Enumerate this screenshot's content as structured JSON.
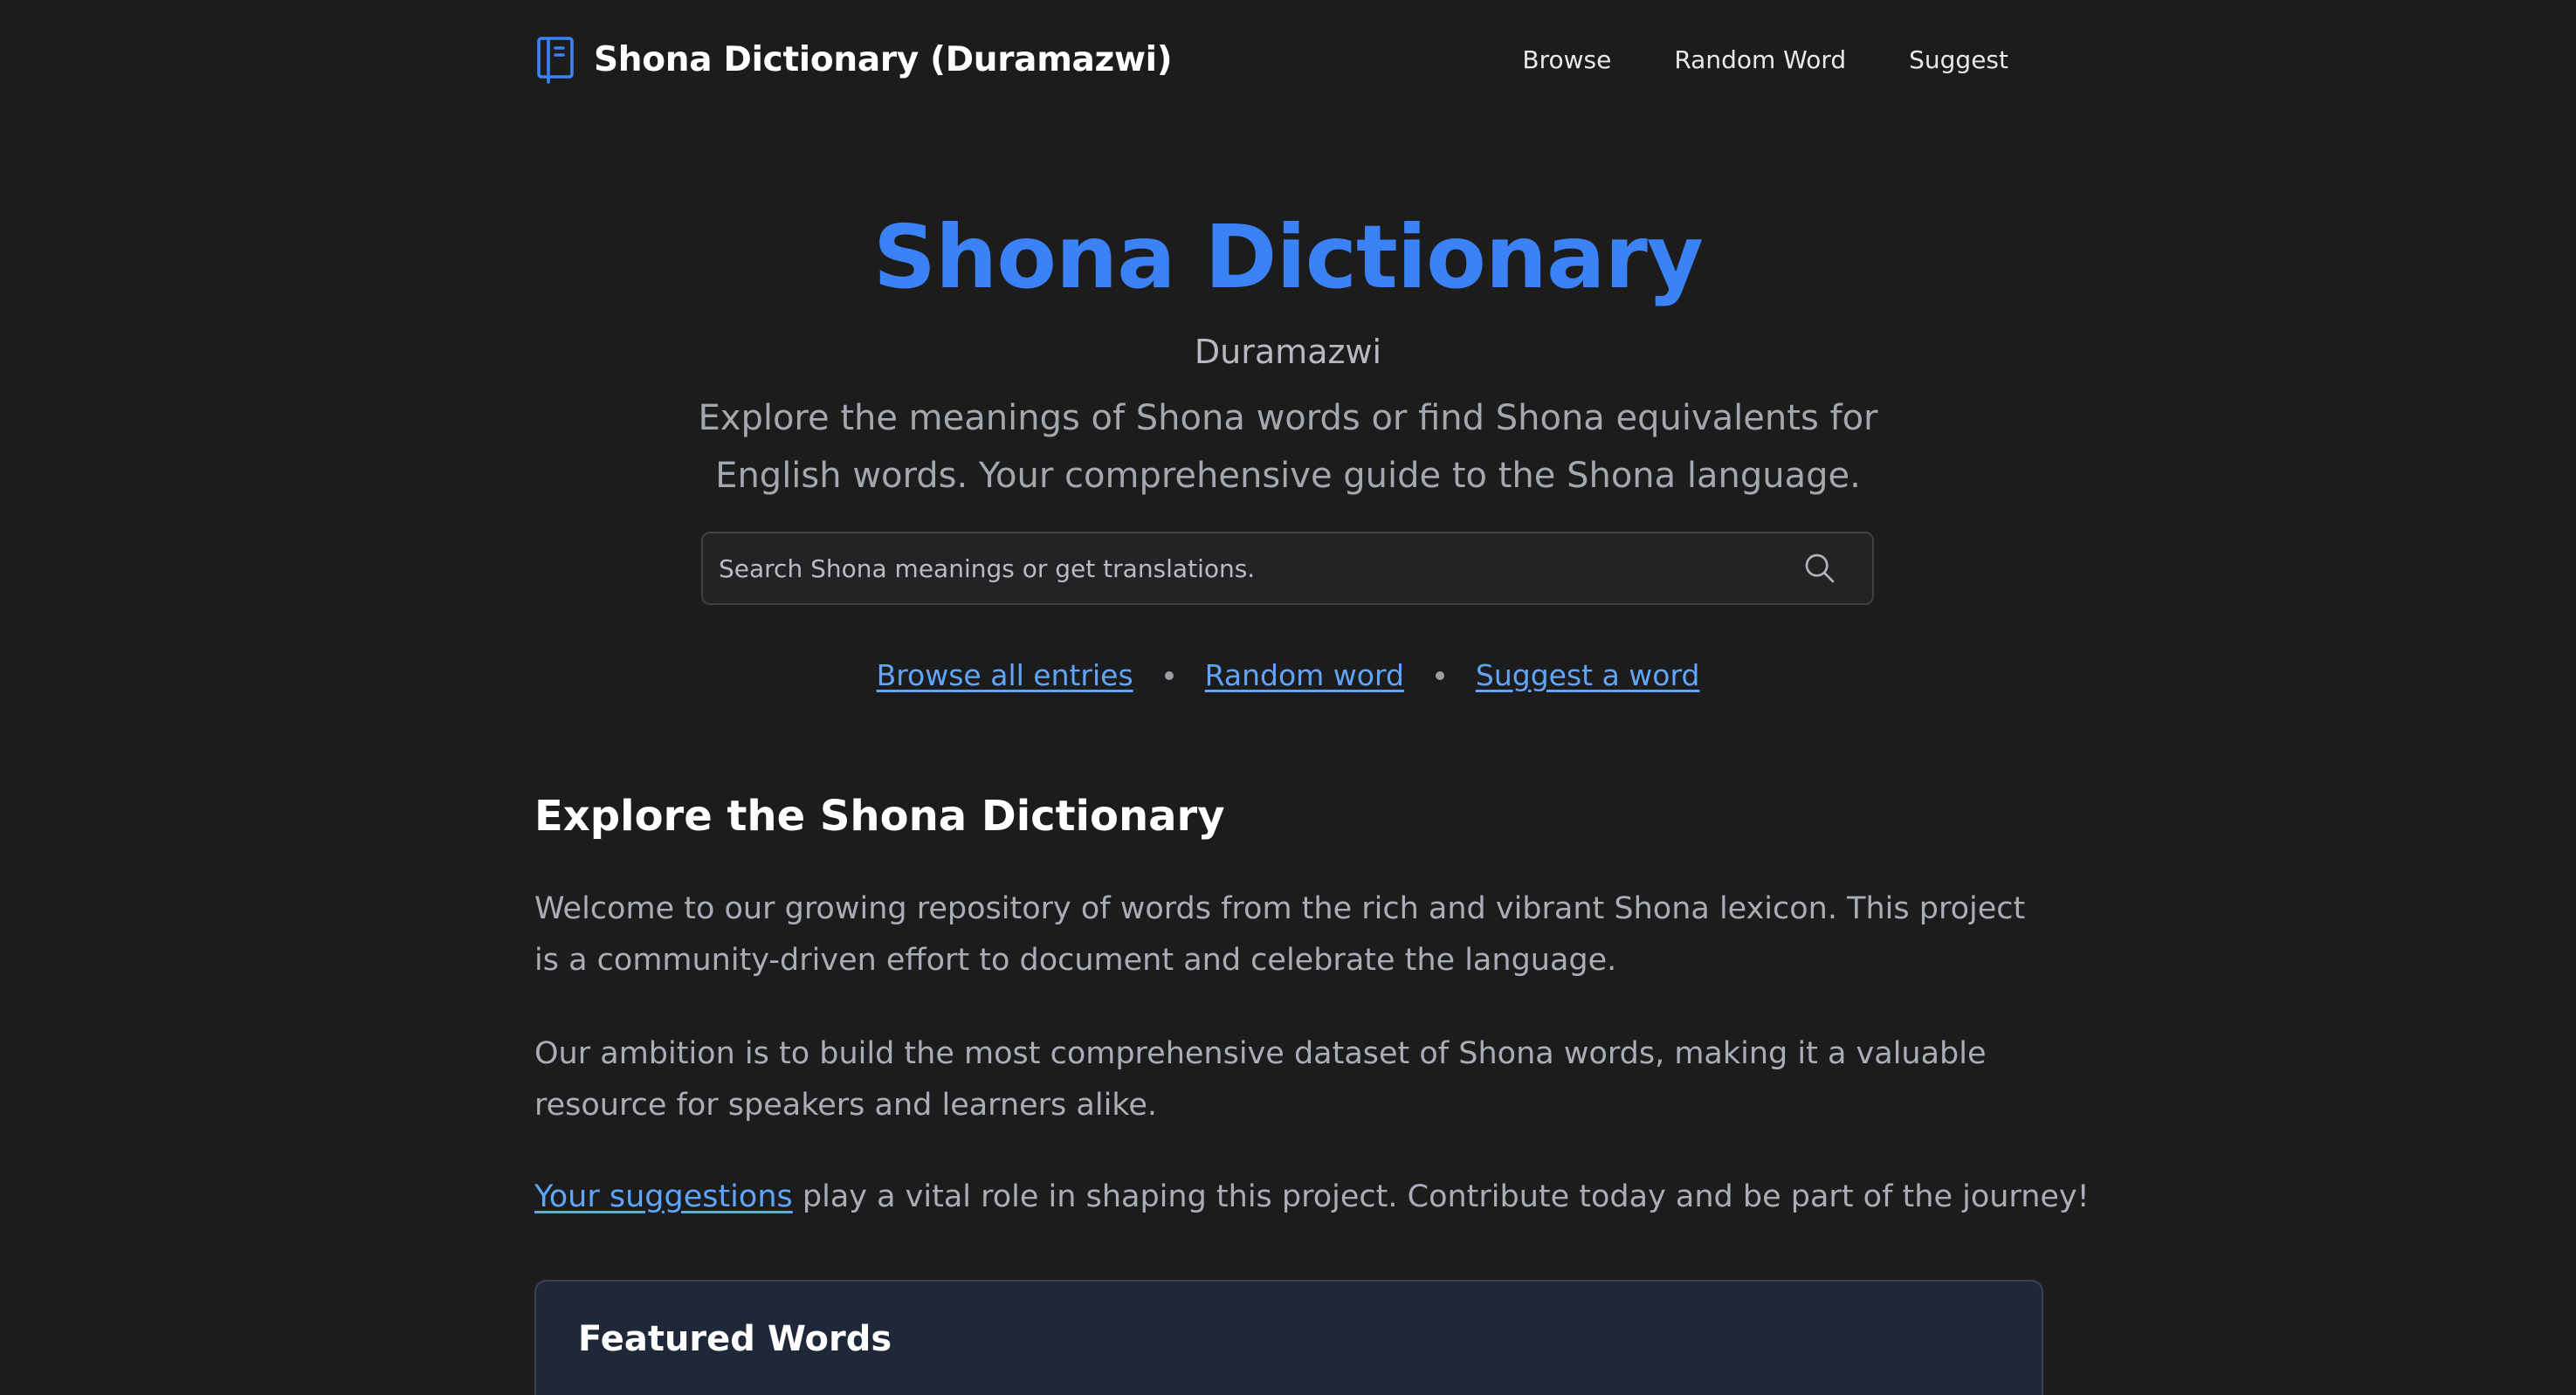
{
  "header": {
    "brand_icon": "book-icon",
    "brand_title": "Shona Dictionary (Duramazwi)",
    "nav": [
      "Browse",
      "Random Word",
      "Suggest"
    ]
  },
  "hero": {
    "title": "Shona Dictionary",
    "subtitle": "Duramazwi",
    "description": "Explore the meanings of Shona words or find Shona equivalents for English words. Your comprehensive guide to the Shona language.",
    "search": {
      "placeholder": "Search Shona meanings or get translations.",
      "value": "",
      "icon": "search-icon"
    },
    "quick_links": [
      "Browse all entries",
      "Random word",
      "Suggest a word"
    ]
  },
  "explore": {
    "heading": "Explore the Shona Dictionary",
    "paragraph_1": "Welcome to our growing repository of words from the rich and vibrant Shona lexicon. This project is a community-driven effort to document and celebrate the language.",
    "paragraph_2": "Our ambition is to build the most comprehensive dataset of Shona words, making it a valuable resource for speakers and learners alike.",
    "paragraph_3_link": "Your suggestions",
    "paragraph_3_rest": " play a vital role in shaping this project. Contribute today and be part of the journey!"
  },
  "featured": {
    "title": "Featured Words"
  },
  "colors": {
    "background": "#1c1c1d",
    "accent": "#3b82f6",
    "link": "#60a5fa",
    "card_background": "#1e2839"
  }
}
